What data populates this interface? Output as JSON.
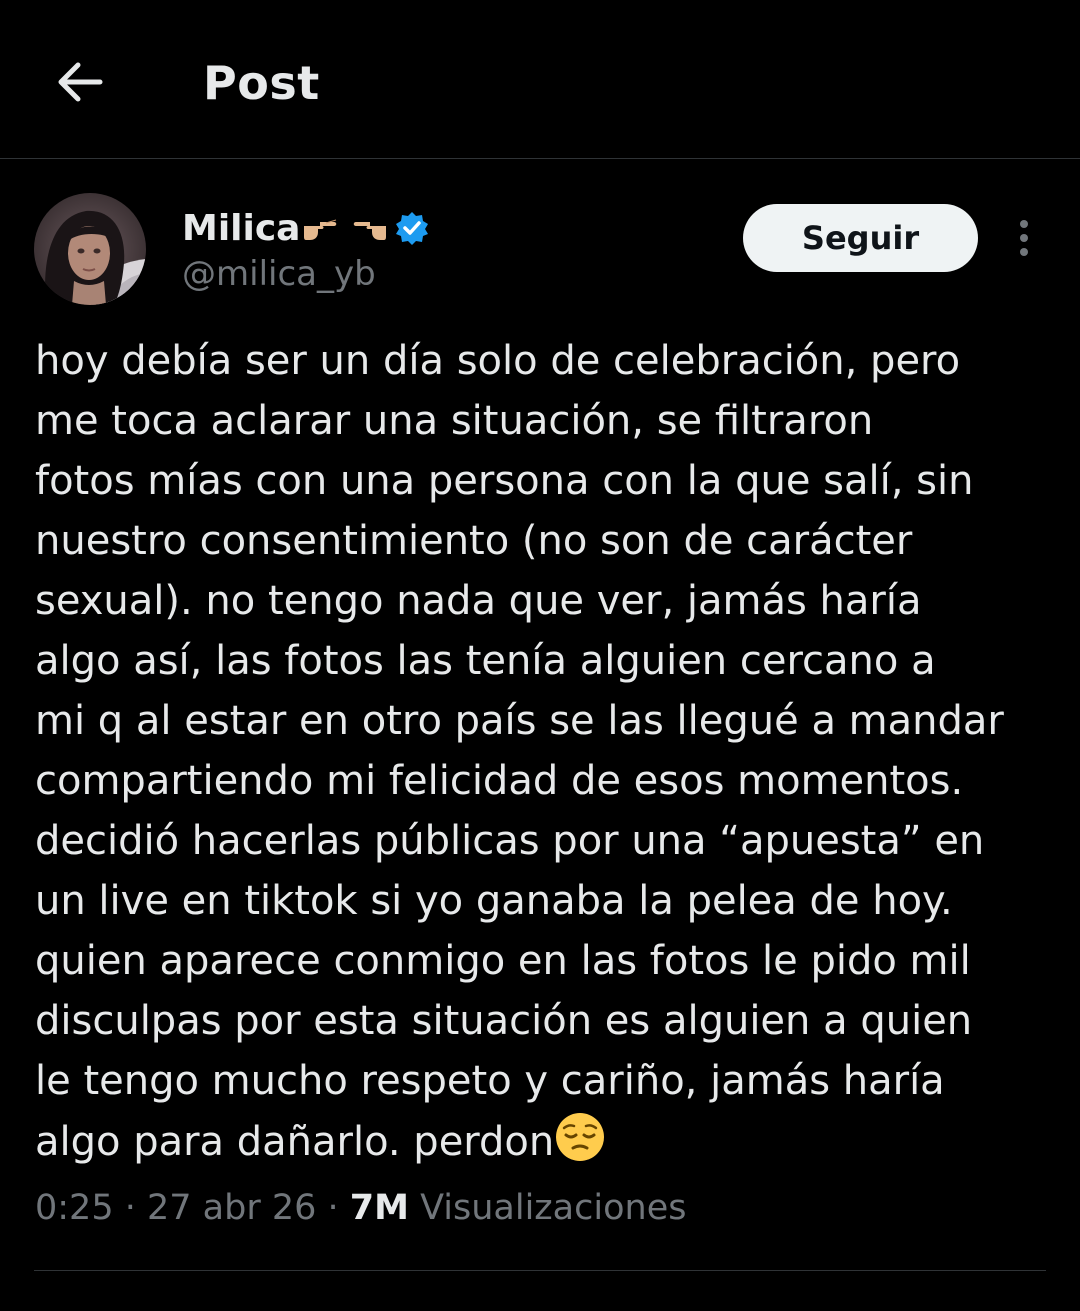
{
  "header": {
    "title": "Post",
    "back_icon": "arrow-left-icon"
  },
  "author": {
    "display_name": "Milica",
    "name_emoji": "👉🏼👈🏼",
    "handle": "@milica_yb",
    "verified": true,
    "verified_color": "#1d9bf0",
    "follow_label": "Seguir",
    "more_icon": "vertical-ellipsis-icon"
  },
  "post": {
    "lines": [
      "hoy debía ser un día solo de celebración, pero",
      "me toca aclarar una situación, se filtraron",
      "fotos mías con una persona con la que salí, sin",
      "nuestro consentimiento (no son de carácter",
      "sexual). no tengo nada que ver,  jamás haría",
      "algo así, las fotos las tenía alguien cercano a",
      "mi q al estar en otro país se las llegué a mandar",
      "compartiendo mi felicidad de esos momentos.",
      "decidió hacerlas públicas por una “apuesta” en",
      "un live en tiktok si yo ganaba la pelea de hoy.",
      "quien aparece conmigo en las fotos le pido mil",
      "disculpas por esta situación es alguien a quien",
      "le tengo mucho respeto y cariño,  jamás haría",
      "algo para dañarlo. perdon"
    ],
    "end_emoji": "pensive-face-emoji"
  },
  "meta": {
    "time": "0:25",
    "separator": " · ",
    "date": "27 abr 26",
    "views_count": "7M",
    "views_label": " Visualizaciones"
  },
  "colors": {
    "background": "#000000",
    "text": "#e7e9ea",
    "secondary": "#71767b",
    "divider": "#2f3336",
    "button_bg": "#eff3f4"
  }
}
